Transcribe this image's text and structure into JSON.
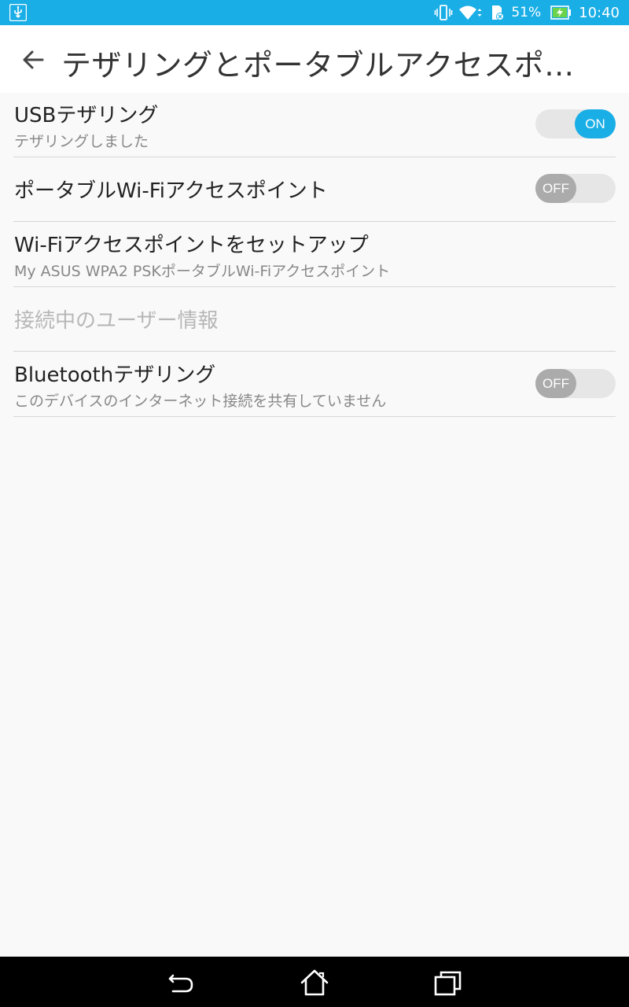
{
  "status_bar": {
    "battery_percent": "51%",
    "time": "10:40",
    "icons": [
      "usb-icon",
      "vibrate-icon",
      "wifi-icon",
      "sd-card-icon",
      "battery-charging-icon"
    ]
  },
  "app_bar": {
    "title": "テザリングとポータブルアクセスポ…",
    "back_icon": "arrow-back-icon"
  },
  "settings": {
    "usb_tethering": {
      "title": "USBテザリング",
      "summary": "テザリングしました",
      "toggle": "ON",
      "enabled": true
    },
    "portable_hotspot": {
      "title": "ポータブルWi-Fiアクセスポイント",
      "toggle": "OFF",
      "enabled": false
    },
    "hotspot_setup": {
      "title": "Wi-Fiアクセスポイントをセットアップ",
      "summary": "My ASUS WPA2 PSKポータブルWi-Fiアクセスポイント"
    },
    "connected_users": {
      "title": "接続中のユーザー情報",
      "disabled": true
    },
    "bluetooth_tethering": {
      "title": "Bluetoothテザリング",
      "summary": "このデバイスのインターネット接続を共有していません",
      "toggle": "OFF",
      "enabled": false
    }
  },
  "nav_bar": {
    "icons": [
      "back-nav-icon",
      "home-icon",
      "recent-apps-icon"
    ]
  },
  "colors": {
    "accent": "#1aaee6",
    "toggle_off": "#ababab",
    "divider": "#d7d7d7"
  }
}
